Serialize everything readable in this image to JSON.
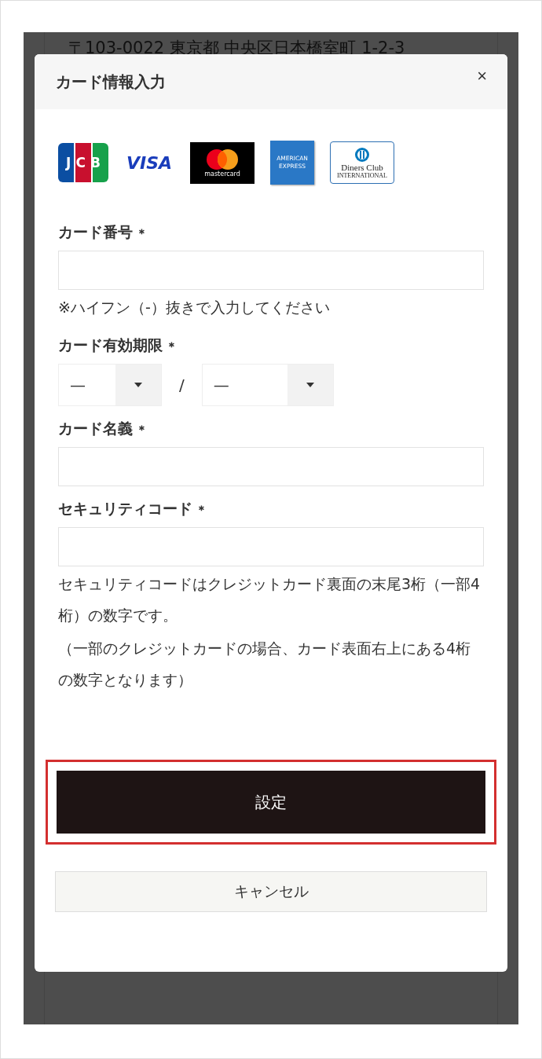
{
  "background": {
    "address": "〒103-0022 東京都 中央区日本橋室町 1-2-3"
  },
  "dialog": {
    "title": "カード情報入力",
    "close": "×"
  },
  "card_brands": [
    {
      "kind": "jcb",
      "text": "JCB"
    },
    {
      "kind": "visa",
      "text": "VISA"
    },
    {
      "kind": "mastercard",
      "text": "mastercard"
    },
    {
      "kind": "amex",
      "text": "AMERICAN EXPRESS"
    },
    {
      "kind": "diners",
      "text": "Diners Club",
      "subtext": "INTERNATIONAL"
    }
  ],
  "fields": [
    {
      "kind": "text",
      "label": "カード番号",
      "required": "＊",
      "note": "※ハイフン（-）抜きで入力してください"
    },
    {
      "kind": "expiry",
      "label": "カード有効期限",
      "required": "＊",
      "month": "—",
      "separator": "/",
      "year": "—"
    },
    {
      "kind": "text",
      "label": "カード名義",
      "required": "＊"
    },
    {
      "kind": "text",
      "label": "セキュリティコード",
      "required": "＊",
      "note": "セキュリティコードはクレジットカード裏面の末尾3桁（一部4桁）の数字です。",
      "note_2": "（一部のクレジットカードの場合、カード表面右上にある4桁の数字となります）"
    }
  ],
  "buttons": [
    {
      "kind": "primary",
      "label": "設定",
      "highlighted": true
    },
    {
      "kind": "secondary",
      "label": "キャンセル",
      "highlighted": false
    }
  ]
}
